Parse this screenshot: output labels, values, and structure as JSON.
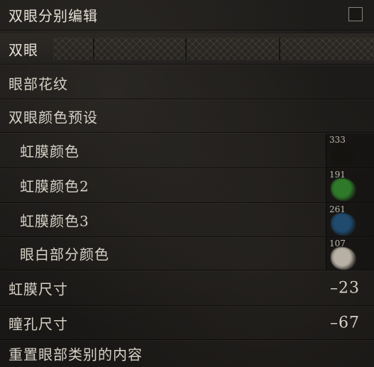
{
  "header": {
    "title": "双眼分别编辑"
  },
  "section": {
    "title": "双眼"
  },
  "rows": {
    "eye_pattern": "眼部花纹",
    "eye_color_preset": "双眼颜色预设",
    "iris_color": {
      "label": "虹膜颜色",
      "value": "333",
      "color": "#151310"
    },
    "iris_color_2": {
      "label": "虹膜颜色2",
      "value": "191",
      "color": "#2f7a2a"
    },
    "iris_color_3": {
      "label": "虹膜颜色3",
      "value": "261",
      "color": "#204a6e"
    },
    "sclera_color": {
      "label": "眼白部分颜色",
      "value": "107",
      "color": "#b8b0a4"
    },
    "iris_size": {
      "label": "虹膜尺寸",
      "value": "–23"
    },
    "pupil_size": {
      "label": "瞳孔尺寸",
      "value": "–67"
    },
    "reset": "重置眼部类别的内容"
  },
  "icons": {
    "checkbox": "checkbox-empty"
  }
}
